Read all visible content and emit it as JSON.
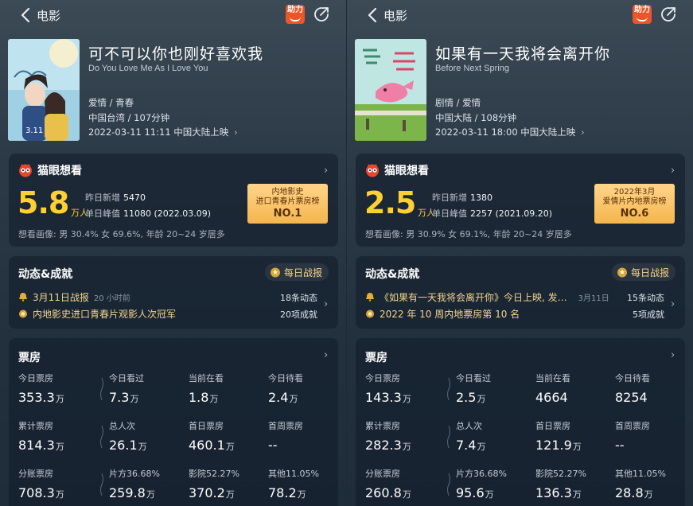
{
  "panels": [
    {
      "nav": {
        "title": "电影",
        "help_badge": "助力"
      },
      "movie": {
        "title": "可不可以你也刚好喜欢我",
        "english_title": "Do You Love Me As I Love You",
        "genre": "爱情 / 青春",
        "region_duration": "中国台湾 / 107分钟",
        "release": "2022-03-11 11:11 中国大陆上映",
        "poster": {
          "date_text": "3.11",
          "theme": "couple-teal"
        }
      },
      "want": {
        "title": "猫眼想看",
        "value": "5.8",
        "unit": "万人",
        "yesterday_label": "昨日新增",
        "yesterday_value": "5470",
        "peak_label": "单日峰值",
        "peak_value": "11080 (2022.03.09)",
        "portrait": "想看画像: 男 30.4%  女 69.6%,  年龄 20~24 岁居多",
        "rank_line1": "内地影史",
        "rank_line2": "进口青春片票房榜",
        "rank_no": "NO.1"
      },
      "news": {
        "title": "动态&成就",
        "daily_label": "每日战报",
        "row1_text": "3月11日战报",
        "row1_time": "20 小时前",
        "row1_count": "18条动态",
        "row2_text": "内地影史进口青春片观影人次冠军",
        "row2_count": "20项成就"
      },
      "box": {
        "title": "票房",
        "cells": [
          {
            "label": "今日票房",
            "value": "353.3",
            "unit": "万"
          },
          {
            "label": "今日看过",
            "value": "7.3",
            "unit": "万"
          },
          {
            "label": "当前在看",
            "value": "1.8",
            "unit": "万"
          },
          {
            "label": "今日待看",
            "value": "2.4",
            "unit": "万"
          },
          {
            "label": "累计票房",
            "value": "814.3",
            "unit": "万"
          },
          {
            "label": "总人次",
            "value": "26.1",
            "unit": "万"
          },
          {
            "label": "首日票房",
            "value": "460.1",
            "unit": "万"
          },
          {
            "label": "首周票房",
            "value": "--",
            "unit": ""
          },
          {
            "label": "分账票房",
            "value": "708.3",
            "unit": "万"
          },
          {
            "label": "片方36.68%",
            "value": "259.8",
            "unit": "万"
          },
          {
            "label": "影院52.27%",
            "value": "370.2",
            "unit": "万"
          },
          {
            "label": "其他11.05%",
            "value": "78.2",
            "unit": "万"
          }
        ]
      }
    },
    {
      "nav": {
        "title": "电影",
        "help_badge": "助力"
      },
      "movie": {
        "title": "如果有一天我将会离开你",
        "english_title": "Before Next Spring",
        "genre": "剧情 / 爱情",
        "region_duration": "中国大陆 / 108分钟",
        "release": "2022-03-11 18:00 中国大陆上映",
        "poster": {
          "date_text": "",
          "theme": "kite-green"
        }
      },
      "want": {
        "title": "猫眼想看",
        "value": "2.5",
        "unit": "万人",
        "yesterday_label": "昨日新增",
        "yesterday_value": "1380",
        "peak_label": "单日峰值",
        "peak_value": "2257 (2021.09.20)",
        "portrait": "想看画像: 男 30.9%  女 69.1%,  年龄 20~24 岁居多",
        "rank_line1": "2022年3月",
        "rank_line2": "爱情片内地票房榜",
        "rank_no": "NO.6"
      },
      "news": {
        "title": "动态&成就",
        "daily_label": "每日战报",
        "row1_text": "《如果有一天我将会离开你》今日上映, 发…",
        "row1_time": "3月11日",
        "row1_count": "15条动态",
        "row2_text": "2022 年 10 周内地票房第 10 名",
        "row2_count": "5项成就"
      },
      "box": {
        "title": "票房",
        "cells": [
          {
            "label": "今日票房",
            "value": "143.3",
            "unit": "万"
          },
          {
            "label": "今日看过",
            "value": "2.5",
            "unit": "万"
          },
          {
            "label": "当前在看",
            "value": "4664",
            "unit": ""
          },
          {
            "label": "今日待看",
            "value": "8254",
            "unit": ""
          },
          {
            "label": "累计票房",
            "value": "282.3",
            "unit": "万"
          },
          {
            "label": "总人次",
            "value": "7.4",
            "unit": "万"
          },
          {
            "label": "首日票房",
            "value": "121.9",
            "unit": "万"
          },
          {
            "label": "首周票房",
            "value": "--",
            "unit": ""
          },
          {
            "label": "分账票房",
            "value": "260.8",
            "unit": "万"
          },
          {
            "label": "片方36.68%",
            "value": "95.6",
            "unit": "万"
          },
          {
            "label": "影院52.27%",
            "value": "136.3",
            "unit": "万"
          },
          {
            "label": "其他11.05%",
            "value": "28.8",
            "unit": "万"
          }
        ]
      }
    }
  ]
}
